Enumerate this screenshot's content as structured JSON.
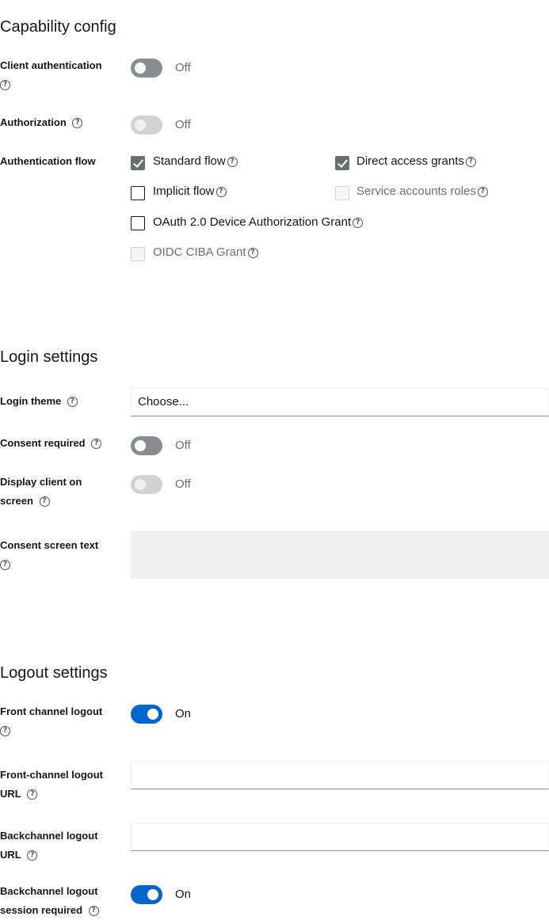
{
  "capability": {
    "title": "Capability config",
    "client_auth": {
      "label": "Client authentication",
      "state": "Off"
    },
    "authorization": {
      "label": "Authorization",
      "state": "Off"
    },
    "auth_flow": {
      "label": "Authentication flow",
      "standard_flow": "Standard flow",
      "direct_access": "Direct access grants",
      "implicit_flow": "Implicit flow",
      "service_accounts": "Service accounts roles",
      "device_grant": "OAuth 2.0 Device Authorization Grant",
      "ciba": "OIDC CIBA Grant"
    }
  },
  "login": {
    "title": "Login settings",
    "theme": {
      "label": "Login theme",
      "value": "Choose..."
    },
    "consent_required": {
      "label": "Consent required",
      "state": "Off"
    },
    "display_client": {
      "label": "Display client on screen",
      "state": "Off"
    },
    "consent_text": {
      "label": "Consent screen text"
    }
  },
  "logout": {
    "title": "Logout settings",
    "front_channel": {
      "label": "Front channel logout",
      "state": "On"
    },
    "front_url": {
      "label": "Front-channel logout URL"
    },
    "back_url": {
      "label": "Backchannel logout URL"
    },
    "back_session": {
      "label": "Backchannel logout session required",
      "state": "On"
    }
  },
  "icons": {
    "help": "help-icon",
    "check": "check-icon"
  },
  "colors": {
    "accent": "#0066cc",
    "switch_off": "#8a8d90",
    "checked": "#6a6e73"
  }
}
